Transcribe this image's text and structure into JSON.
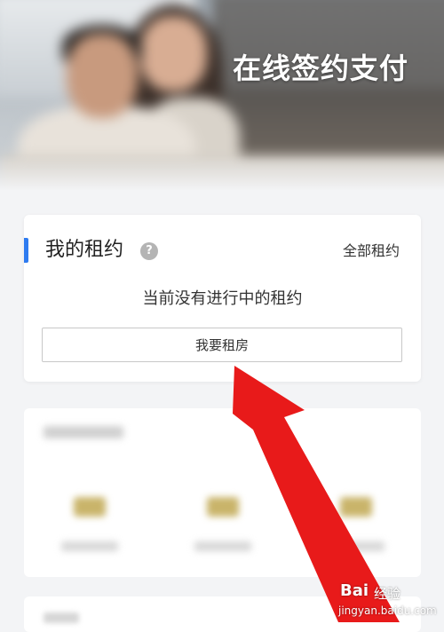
{
  "banner": {
    "title": "在线签约支付"
  },
  "rental_card": {
    "title": "我的租约",
    "help_icon": "question-circle-icon",
    "all_link": "全部租约",
    "empty_message": "当前没有进行中的租约",
    "rent_button": "我要租房",
    "accent_color": "#2e7bf0"
  },
  "annotation": {
    "arrow_color": "#e81a1a",
    "icon": "red-pointer-arrow-icon"
  },
  "watermark": {
    "brand": "Bai",
    "brand_suffix": "经验",
    "url": "jingyan.baidu.com"
  }
}
